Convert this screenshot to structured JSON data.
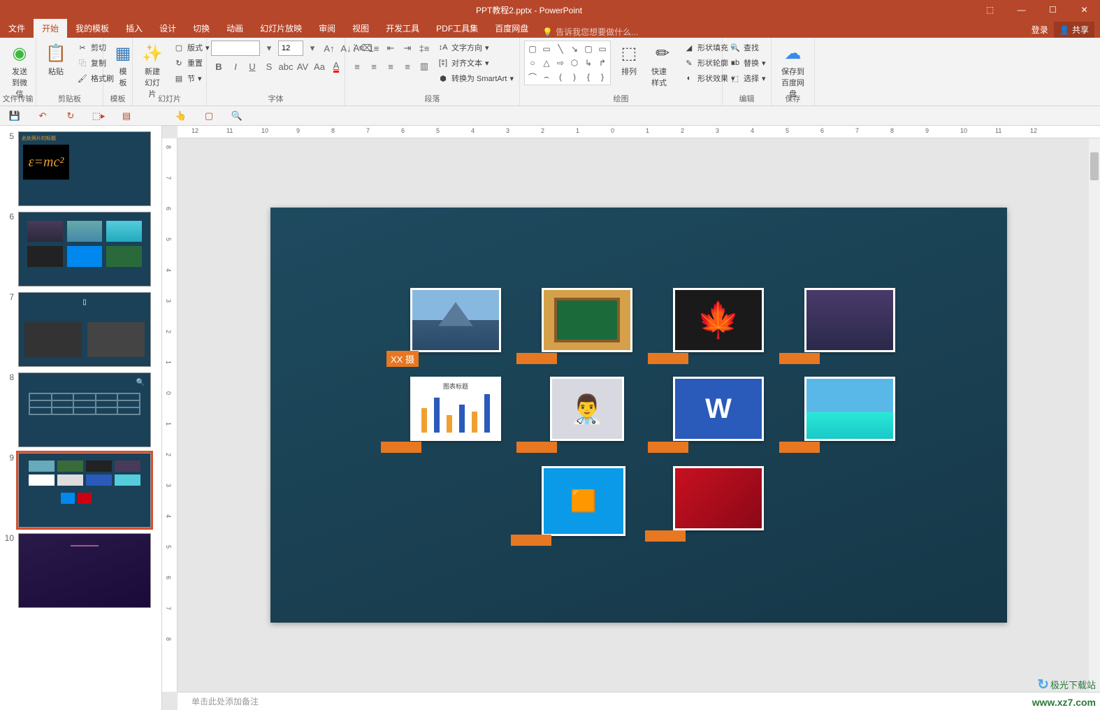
{
  "title": "PPT教程2.pptx - PowerPoint",
  "window_controls": {
    "min": "—",
    "max": "☐",
    "close": "✕",
    "opts": "⬚"
  },
  "menu": {
    "tabs": [
      "文件",
      "开始",
      "我的模板",
      "插入",
      "设计",
      "切换",
      "动画",
      "幻灯片放映",
      "审阅",
      "视图",
      "开发工具",
      "PDF工具集",
      "百度网盘"
    ],
    "active_index": 1,
    "tell_me": "告诉我您想要做什么...",
    "login": "登录",
    "share": "共享"
  },
  "ribbon": {
    "groups": {
      "file_transfer": {
        "label": "文件传输",
        "wechat": "发送\n到微信"
      },
      "clipboard": {
        "label": "剪贴板",
        "paste": "粘贴",
        "cut": "剪切",
        "copy": "复制",
        "format_painter": "格式刷"
      },
      "template": {
        "label": "模板",
        "btn": "模\n板"
      },
      "slides": {
        "label": "幻灯片",
        "new_slide": "新建\n幻灯片",
        "layout": "版式",
        "reset": "重置",
        "section": "节"
      },
      "font": {
        "label": "字体",
        "name": "",
        "size": "12"
      },
      "paragraph": {
        "label": "段落",
        "text_dir": "文字方向",
        "align_text": "对齐文本",
        "smartart": "转换为 SmartArt"
      },
      "drawing": {
        "label": "绘图",
        "arrange": "排列",
        "quick_styles": "快速样式",
        "shape_fill": "形状填充",
        "shape_outline": "形状轮廓",
        "shape_effects": "形状效果"
      },
      "editing": {
        "label": "编辑",
        "find": "查找",
        "replace": "替换",
        "select": "选择"
      },
      "save": {
        "label": "保存",
        "baidu": "保存到\n百度网盘"
      }
    }
  },
  "ruler_h": [
    "12",
    "11",
    "10",
    "9",
    "8",
    "7",
    "6",
    "5",
    "4",
    "3",
    "2",
    "1",
    "0",
    "1",
    "2",
    "3",
    "4",
    "5",
    "6",
    "7",
    "8",
    "9",
    "10",
    "11",
    "12"
  ],
  "ruler_v": [
    "8",
    "7",
    "6",
    "5",
    "4",
    "3",
    "2",
    "1",
    "0",
    "1",
    "2",
    "3",
    "4",
    "5",
    "6",
    "7",
    "8"
  ],
  "slides": [
    {
      "num": "5",
      "title_bar": "此处照片的标题"
    },
    {
      "num": "6"
    },
    {
      "num": "7"
    },
    {
      "num": "8"
    },
    {
      "num": "9",
      "selected": true
    },
    {
      "num": "10"
    }
  ],
  "canvas": {
    "label_xx": "XX 摄",
    "chart_title": "图表标题"
  },
  "notes_placeholder": "单击此处添加备注",
  "watermark": {
    "name": "极光下载站",
    "url": "www.xz7.com"
  }
}
